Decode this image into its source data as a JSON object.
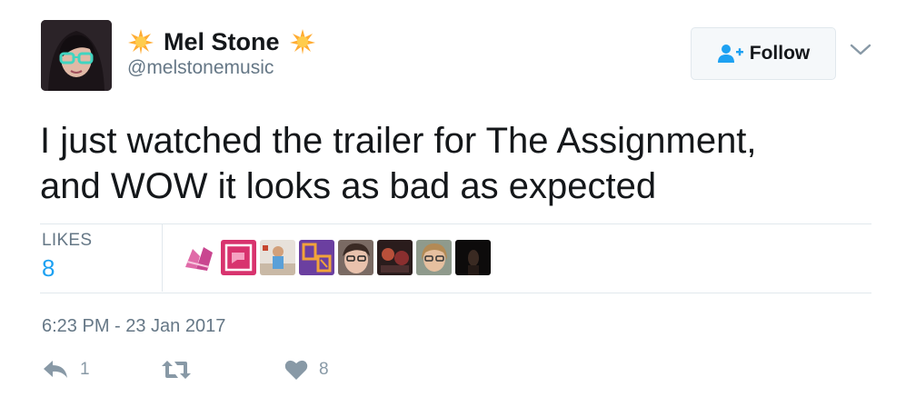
{
  "tweet": {
    "author": {
      "name": "Mel Stone",
      "handle": "@melstonemusic",
      "name_decoration_icon": "star-sun-icon"
    },
    "follow_button": {
      "label": "Follow",
      "icon": "follow-user-plus-icon"
    },
    "menu_icon": "chevron-down-icon",
    "text_lines": [
      "I just watched the trailer for The Assignment,",
      "and WOW it looks as bad as expected"
    ],
    "stats": {
      "likes_label": "LIKES",
      "likes_count": "8"
    },
    "likers": [
      "liker-1",
      "liker-2",
      "liker-3",
      "liker-4",
      "liker-5",
      "liker-6",
      "liker-7",
      "liker-8"
    ],
    "timestamp": "6:23 PM - 23 Jan 2017",
    "actions": {
      "reply": {
        "icon": "reply-icon",
        "count": "1"
      },
      "retweet": {
        "icon": "retweet-icon",
        "count": ""
      },
      "like": {
        "icon": "heart-icon",
        "count": "8"
      }
    },
    "colors": {
      "accent": "#1da1f2",
      "muted": "#657786",
      "star": "#ffac33"
    }
  }
}
